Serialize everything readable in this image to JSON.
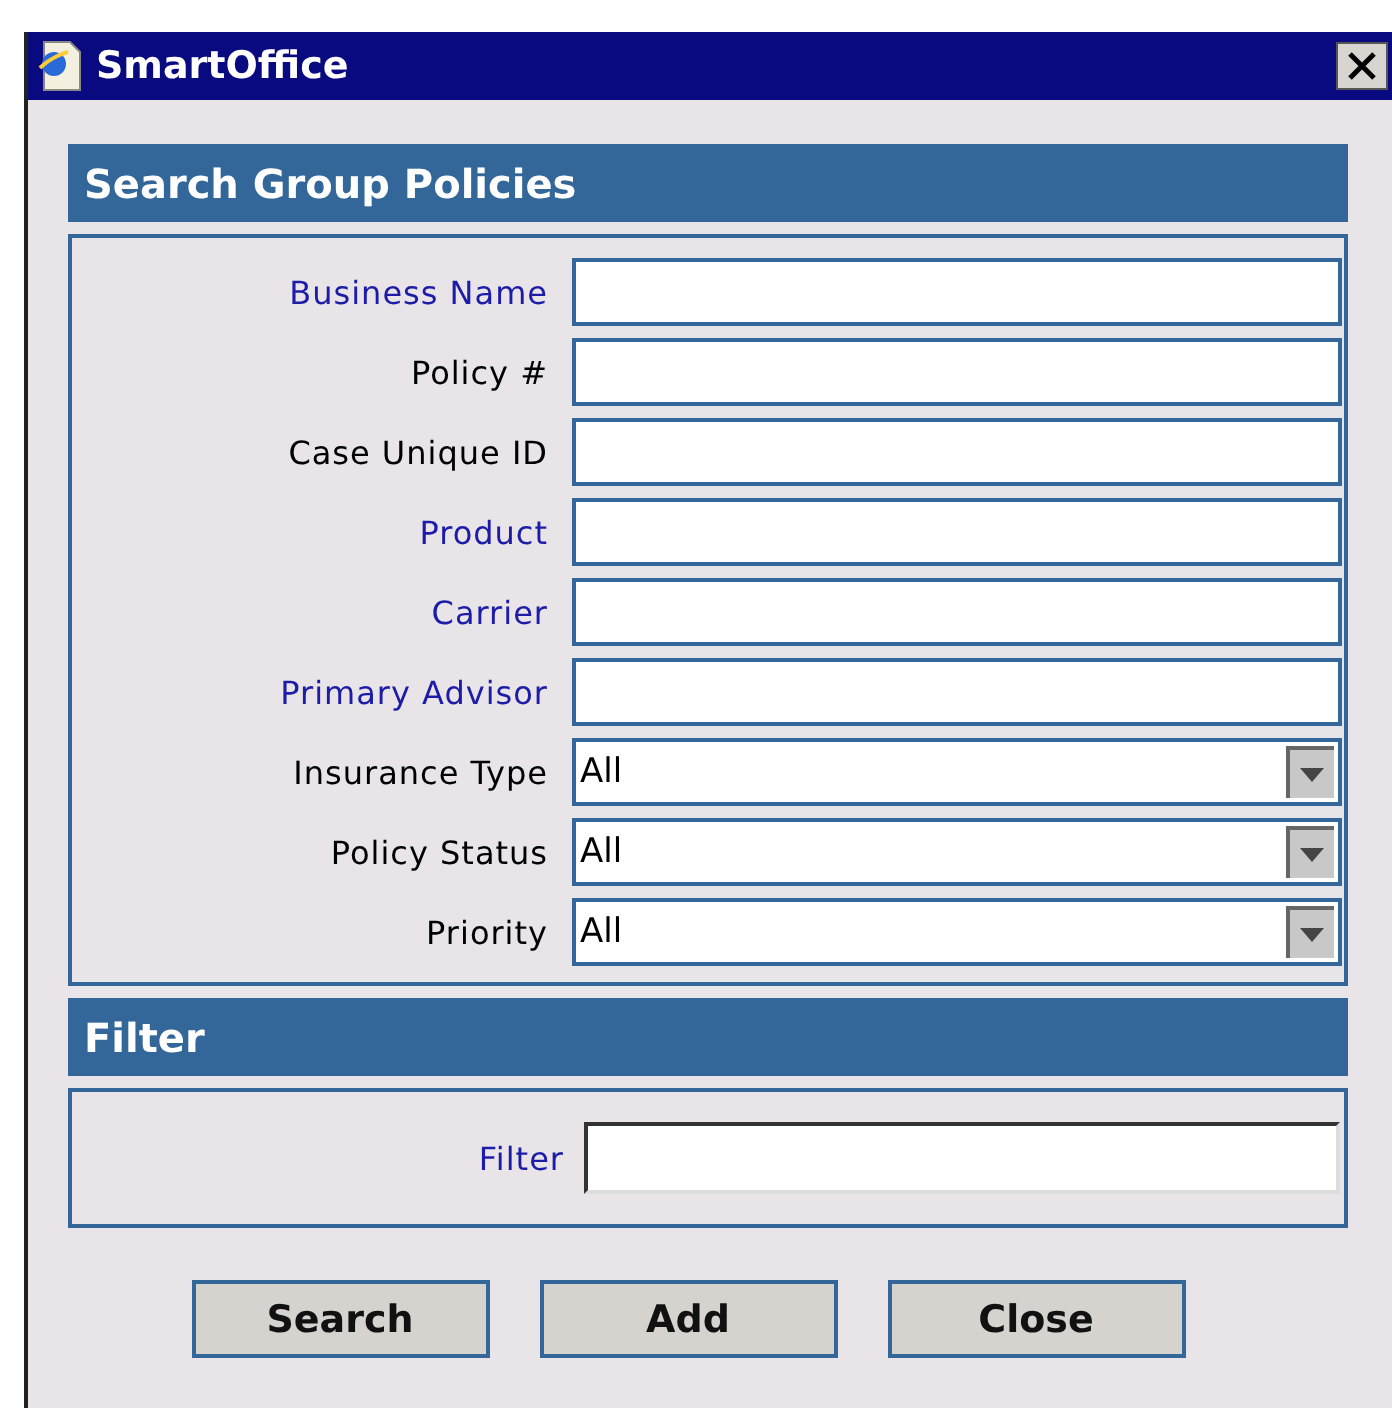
{
  "window": {
    "title": "SmartOffice"
  },
  "search_panel": {
    "title": "Search Group Policies",
    "fields": [
      {
        "label": "Business Name",
        "kind": "text",
        "color": "#1c1ca8"
      },
      {
        "label": "Policy #",
        "kind": "text",
        "color": "#000000"
      },
      {
        "label": "Case Unique ID",
        "kind": "text",
        "color": "#000000"
      },
      {
        "label": "Product",
        "kind": "text",
        "color": "#1c1ca8"
      },
      {
        "label": "Carrier",
        "kind": "text",
        "color": "#1c1ca8"
      },
      {
        "label": "Primary Advisor",
        "kind": "text",
        "color": "#1c1ca8"
      },
      {
        "label": "Insurance Type",
        "kind": "select",
        "value": "All",
        "color": "#000000"
      },
      {
        "label": "Policy Status",
        "kind": "select",
        "value": "All",
        "color": "#000000"
      },
      {
        "label": "Priority",
        "kind": "select",
        "value": "All",
        "color": "#000000"
      }
    ]
  },
  "filter_panel": {
    "title": "Filter",
    "label": "Filter"
  },
  "buttons": [
    "Search",
    "Add",
    "Close"
  ]
}
